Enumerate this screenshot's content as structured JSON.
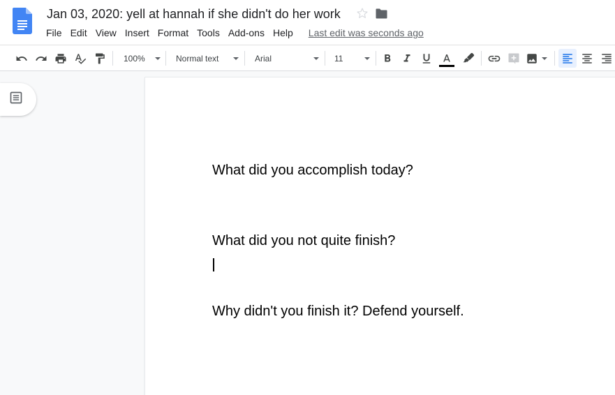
{
  "header": {
    "title": "Jan 03, 2020: yell at hannah if she didn't do her work",
    "icons": {
      "logo": "google-docs-icon",
      "star": "star-icon",
      "folder": "folder-icon"
    },
    "menu": [
      "File",
      "Edit",
      "View",
      "Insert",
      "Format",
      "Tools",
      "Add-ons",
      "Help"
    ],
    "last_edit": "Last edit was seconds ago"
  },
  "toolbar": {
    "zoom": "100%",
    "style": "Normal text",
    "font": "Arial",
    "font_size": "11",
    "buttons": [
      "undo-icon",
      "redo-icon",
      "print-icon",
      "spellcheck-icon",
      "paint-format-icon",
      "bold-icon",
      "italic-icon",
      "underline-icon",
      "text-color-icon",
      "highlight-icon",
      "link-icon",
      "comment-icon",
      "image-icon",
      "align-left-icon",
      "align-center-icon",
      "align-right-icon"
    ],
    "active_alignment": "left",
    "colors": {
      "text_color_bar": "#000000",
      "active_bg": "#e8f0fe",
      "accent": "#1a73e8"
    }
  },
  "sidebar": {
    "outline_icon": "document-outline-icon"
  },
  "document": {
    "paragraphs": [
      "What did you accomplish today?",
      "What did you not quite finish?",
      "Why didn't you finish it? Defend yourself."
    ]
  }
}
